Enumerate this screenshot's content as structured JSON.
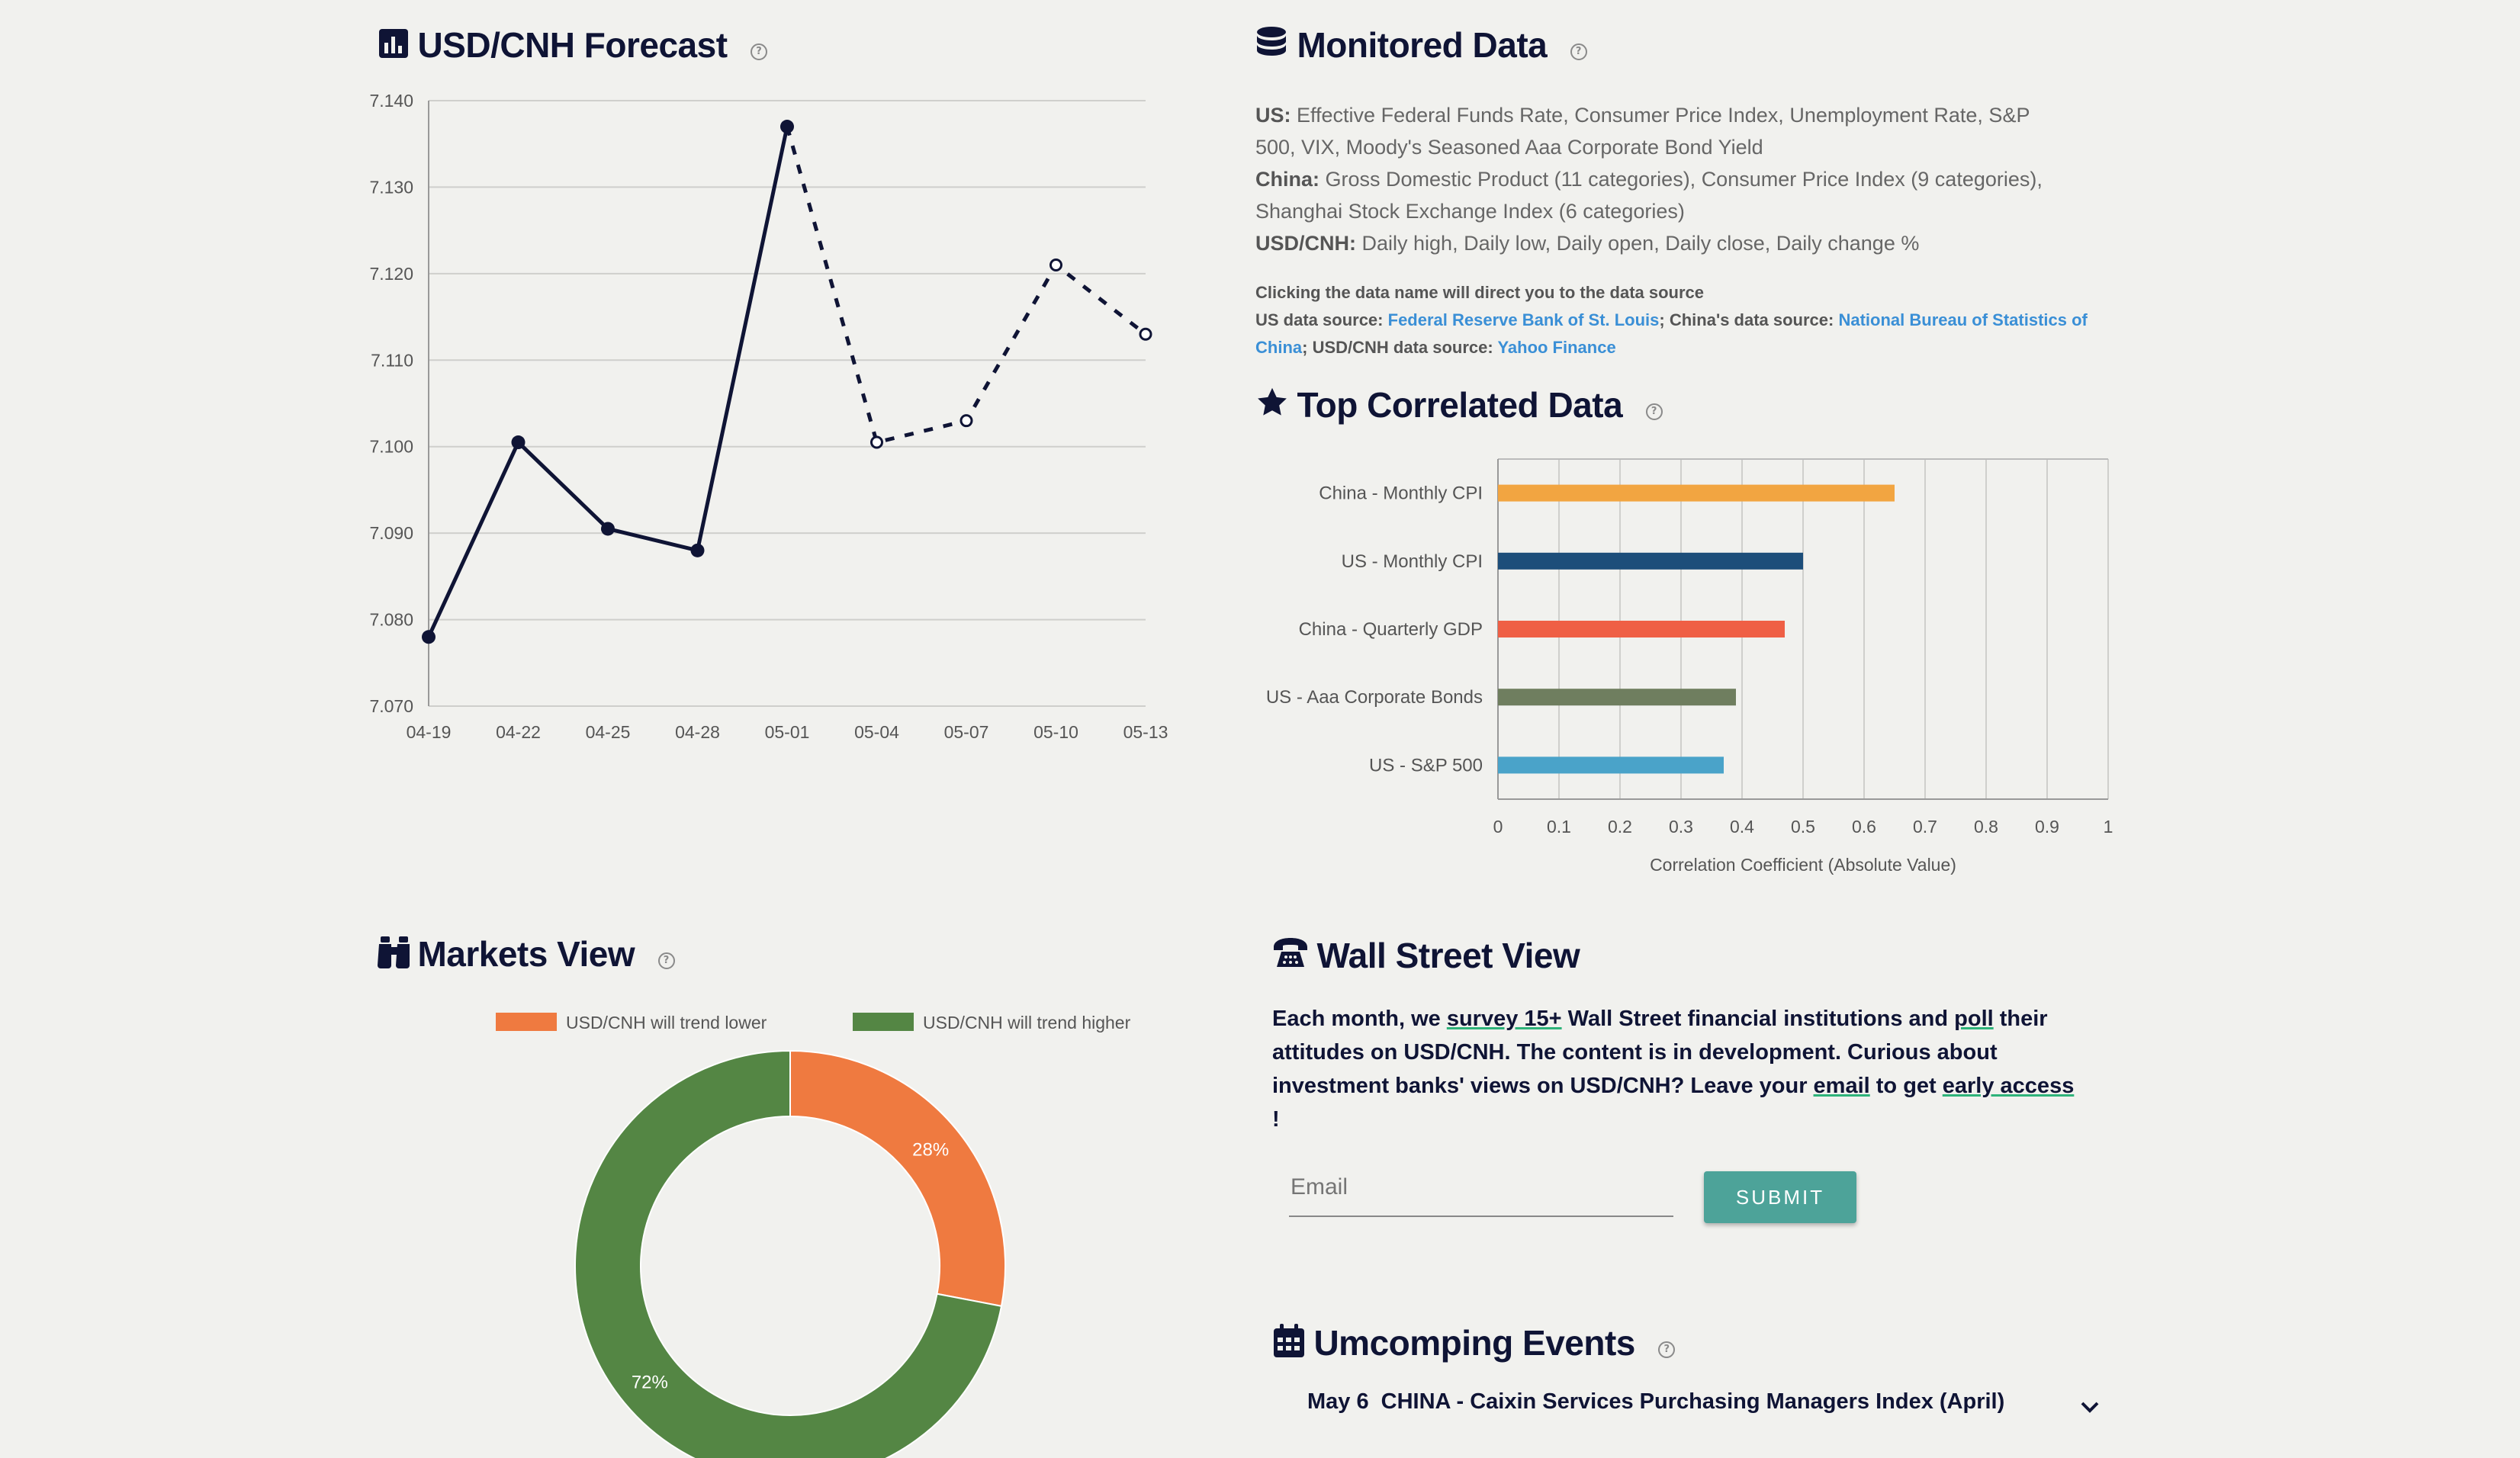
{
  "forecast": {
    "title": "USD/CNH Forecast",
    "help": "?"
  },
  "monitored": {
    "title": "Monitored Data",
    "help": "?",
    "us_label": "US:",
    "us_text": "Effective Federal Funds Rate, Consumer Price Index, Unemployment Rate, S&P 500, VIX, Moody's Seasoned Aaa Corporate Bond Yield",
    "china_label": "China:",
    "china_text": "Gross Domestic Product (11 categories), Consumer Price Index (9 categories), Shanghai Stock Exchange Index (6 categories)",
    "fx_label": "USD/CNH:",
    "fx_text": "Daily high, Daily low, Daily open, Daily close, Daily change %",
    "click_note": "Clicking the data name will direct you to the data source",
    "us_source_label": "US data source:",
    "us_source_link": "Federal Reserve Bank of St. Louis",
    "china_source_label": "; China's data source:",
    "china_source_link": "National Bureau of Statistics of China",
    "fx_source_label": "; USD/CNH data source:",
    "fx_source_link": "Yahoo Finance"
  },
  "correlated": {
    "title": "Top Correlated Data",
    "help": "?"
  },
  "markets": {
    "title": "Markets View",
    "help": "?"
  },
  "wallstreet": {
    "title": "Wall Street View",
    "p1": "Each month, we ",
    "survey": "survey 15+",
    "p2": " Wall Street financial institutions and ",
    "poll": "poll",
    "p3": " their attitudes on USD/CNH. The content is in development. Curious about investment banks' views on USD/CNH? Leave your ",
    "email_word": "email",
    "p4": " to get ",
    "early": "early access",
    "p5": " !",
    "email_placeholder": "Email",
    "submit": "SUBMIT"
  },
  "events": {
    "title": "Umcomping Events",
    "help": "?",
    "items": [
      {
        "date": "May 6",
        "text": "CHINA - Caixin Services Purchasing Managers Index (April)"
      }
    ]
  },
  "colors": {
    "navy": "#0f1435",
    "orange": "#ef7a40",
    "green": "#548644",
    "teal": "#4da399",
    "link": "#3a8fd6"
  },
  "chart_data": [
    {
      "type": "line",
      "x": [
        "04-19",
        "04-22",
        "04-25",
        "04-28",
        "05-01",
        "05-04",
        "05-07",
        "05-10",
        "05-13"
      ],
      "series": [
        {
          "style": "solid",
          "values": [
            7.078,
            7.1005,
            7.0905,
            7.088,
            7.137,
            null,
            null,
            null,
            null
          ]
        },
        {
          "style": "dashed",
          "values": [
            null,
            null,
            null,
            null,
            7.137,
            7.1005,
            7.103,
            7.121,
            7.113
          ]
        }
      ],
      "yticks": [
        "7.070",
        "7.080",
        "7.090",
        "7.100",
        "7.110",
        "7.120",
        "7.130",
        "7.140"
      ],
      "ylim": [
        7.07,
        7.14
      ],
      "grid": true
    },
    {
      "type": "bar",
      "orientation": "horizontal",
      "categories": [
        "China - Monthly CPI",
        "US - Monthly CPI",
        "China - Quarterly GDP",
        "US - Aaa Corporate Bonds",
        "US - S&P 500"
      ],
      "values": [
        0.65,
        0.5,
        0.47,
        0.39,
        0.37
      ],
      "colors": [
        "#f2a541",
        "#1d4e7a",
        "#ef5f45",
        "#6f7e5f",
        "#4aa3c9"
      ],
      "xticks": [
        "0",
        "0.1",
        "0.2",
        "0.3",
        "0.4",
        "0.5",
        "0.6",
        "0.7",
        "0.8",
        "0.9",
        "1"
      ],
      "xlim": [
        0,
        1
      ],
      "xlabel": "Correlation Coefficient (Absolute Value)",
      "grid": true
    },
    {
      "type": "pie",
      "labels": [
        "USD/CNH will trend lower",
        "USD/CNH will trend higher"
      ],
      "values": [
        28,
        72
      ],
      "value_labels": [
        "28%",
        "72%"
      ],
      "colors": [
        "#ef7a40",
        "#548644"
      ],
      "donut": true,
      "legend": "top"
    }
  ]
}
